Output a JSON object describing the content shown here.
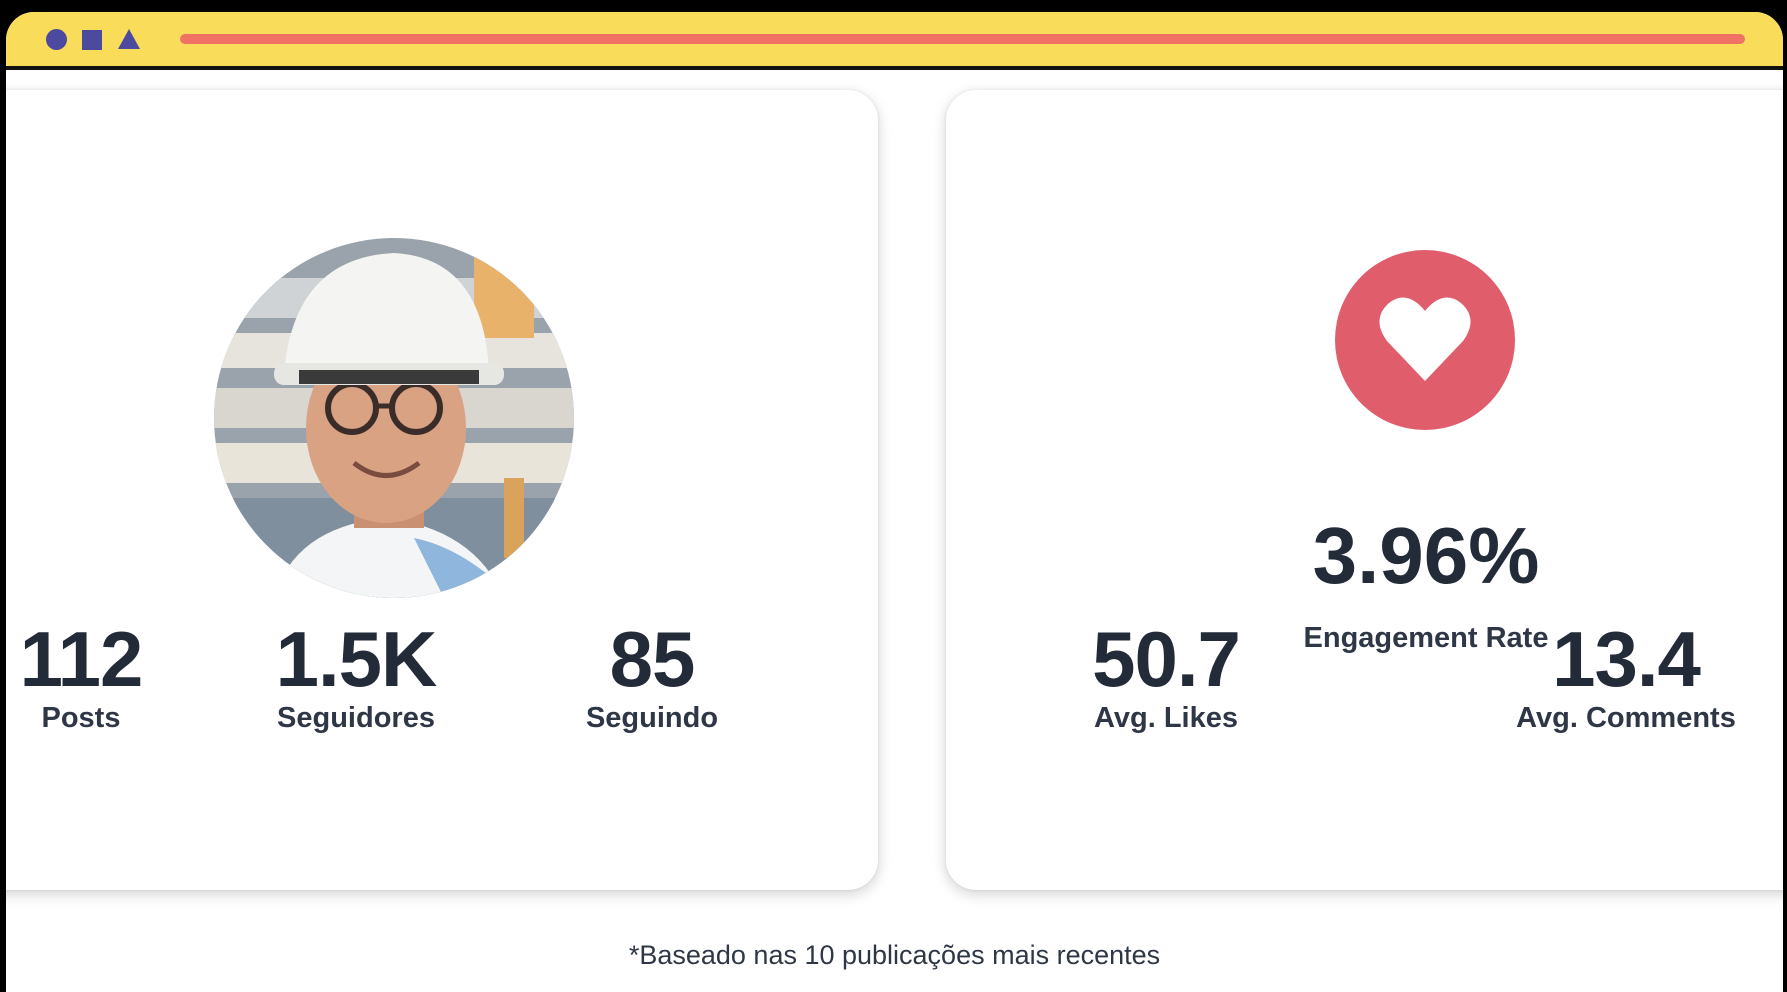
{
  "window": {
    "titlebar_icons": [
      "circle-icon",
      "square-icon",
      "triangle-icon"
    ],
    "accent": "#f8dc5a",
    "bar_color": "#f07264"
  },
  "profile": {
    "stats": [
      {
        "value": "112",
        "label": "Posts"
      },
      {
        "value": "1.5K",
        "label": "Seguidores"
      },
      {
        "value": "85",
        "label": "Seguindo"
      }
    ]
  },
  "engagement": {
    "icon": "heart-icon",
    "rate": "3.96%",
    "rate_label": "Engagement Rate",
    "stats": [
      {
        "value": "50.7",
        "label": "Avg. Likes"
      },
      {
        "value": "13.4",
        "label": "Avg. Comments"
      }
    ]
  },
  "footnote": "*Baseado nas 10 publicações mais recentes"
}
